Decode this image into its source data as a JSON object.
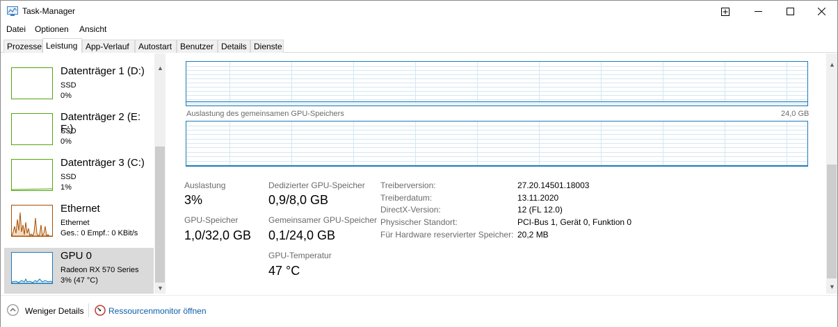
{
  "window": {
    "title": "Task-Manager"
  },
  "menu": [
    "Datei",
    "Optionen",
    "Ansicht"
  ],
  "tabs": [
    "Prozesse",
    "Leistung",
    "App-Verlauf",
    "Autostart",
    "Benutzer",
    "Details",
    "Dienste"
  ],
  "active_tab": "Leistung",
  "devices": [
    {
      "name": "Datenträger 1 (D:)",
      "line1": "SSD",
      "line2": "0%",
      "color": "#4da60c"
    },
    {
      "name": "Datenträger 2 (E: F:)",
      "line1": "SSD",
      "line2": "0%",
      "color": "#4da60c"
    },
    {
      "name": "Datenträger 3 (C:)",
      "line1": "SSD",
      "line2": "1%",
      "color": "#4da60c"
    },
    {
      "name": "Ethernet",
      "line1": "Ethernet",
      "line2": "Ges.: 0 Empf.: 0 KBit/s",
      "color": "#a74f01"
    },
    {
      "name": "GPU 0",
      "line1": "Radeon RX 570 Series",
      "line2": "3% (47 °C)",
      "color": "#1c7ab8"
    }
  ],
  "selected_device": "GPU 0",
  "graphs": {
    "shared_mem_caption": "Auslastung des gemeinsamen GPU-Speichers",
    "shared_mem_max": "24,0 GB"
  },
  "stats": {
    "utilization_label": "Auslastung",
    "utilization_value": "3%",
    "dedicated_label": "Dedizierter GPU-Speicher",
    "dedicated_value": "0,9/8,0 GB",
    "gpu_mem_label": "GPU-Speicher",
    "gpu_mem_value": "1,0/32,0 GB",
    "shared_label": "Gemeinsamer GPU-Speicher",
    "shared_value": "0,1/24,0 GB",
    "temp_label": "GPU-Temperatur",
    "temp_value": "47 °C"
  },
  "properties": [
    {
      "label": "Treiberversion:",
      "value": "27.20.14501.18003"
    },
    {
      "label": "Treiberdatum:",
      "value": "13.11.2020"
    },
    {
      "label": "DirectX-Version:",
      "value": "12 (FL 12.0)"
    },
    {
      "label": "Physischer Standort:",
      "value": "PCI-Bus 1, Gerät 0, Funktion 0"
    },
    {
      "label": "Für Hardware reservierter Speicher:",
      "value": "20,2 MB"
    }
  ],
  "footer": {
    "fewer_details": "Weniger Details",
    "resource_monitor": "Ressourcenmonitor öffnen"
  },
  "icons": [
    "task-manager-icon",
    "compact-view-icon",
    "minimize-icon",
    "maximize-icon",
    "close-icon",
    "chevron-up-circle-icon",
    "resource-monitor-icon"
  ]
}
